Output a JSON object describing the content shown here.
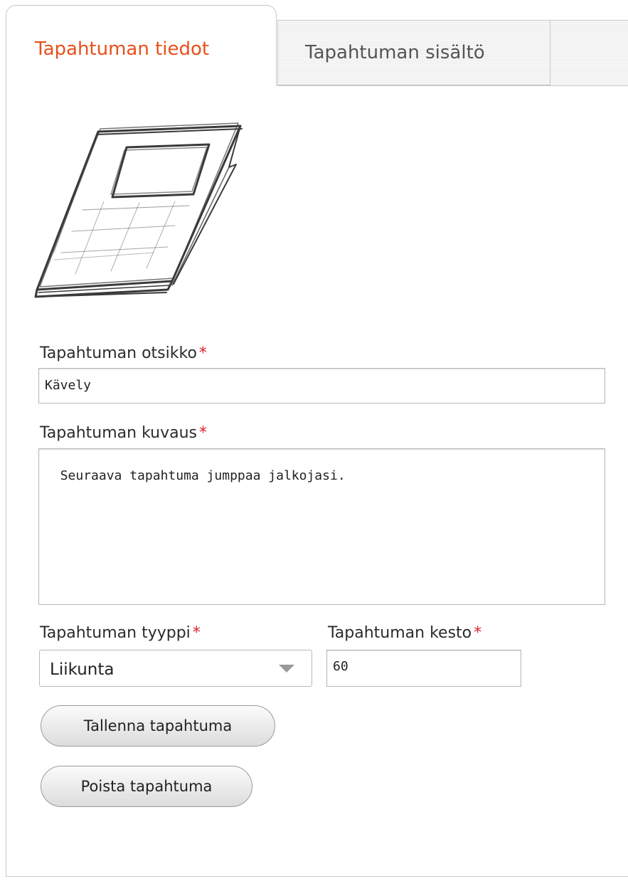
{
  "tabs": [
    {
      "label": "Tapahtuman tiedot",
      "active": true
    },
    {
      "label": "Tapahtuman sisältö",
      "active": false
    }
  ],
  "image": {
    "icon": "book-sketch-icon"
  },
  "form": {
    "title": {
      "label": "Tapahtuman otsikko",
      "required_mark": "*",
      "value": "Kävely"
    },
    "description": {
      "label": "Tapahtuman kuvaus",
      "required_mark": "*",
      "value": "Seuraava tapahtuma jumppaa jalkojasi."
    },
    "type": {
      "label": "Tapahtuman tyyppi",
      "required_mark": "*",
      "value": "Liikunta"
    },
    "duration": {
      "label": "Tapahtuman kesto",
      "required_mark": "*",
      "value": "60"
    }
  },
  "buttons": {
    "save": "Tallenna tapahtuma",
    "delete": "Poista tapahtuma"
  },
  "colors": {
    "active_tab": "#e8501a",
    "required": "#e0202a",
    "border": "#c8c8c8"
  }
}
